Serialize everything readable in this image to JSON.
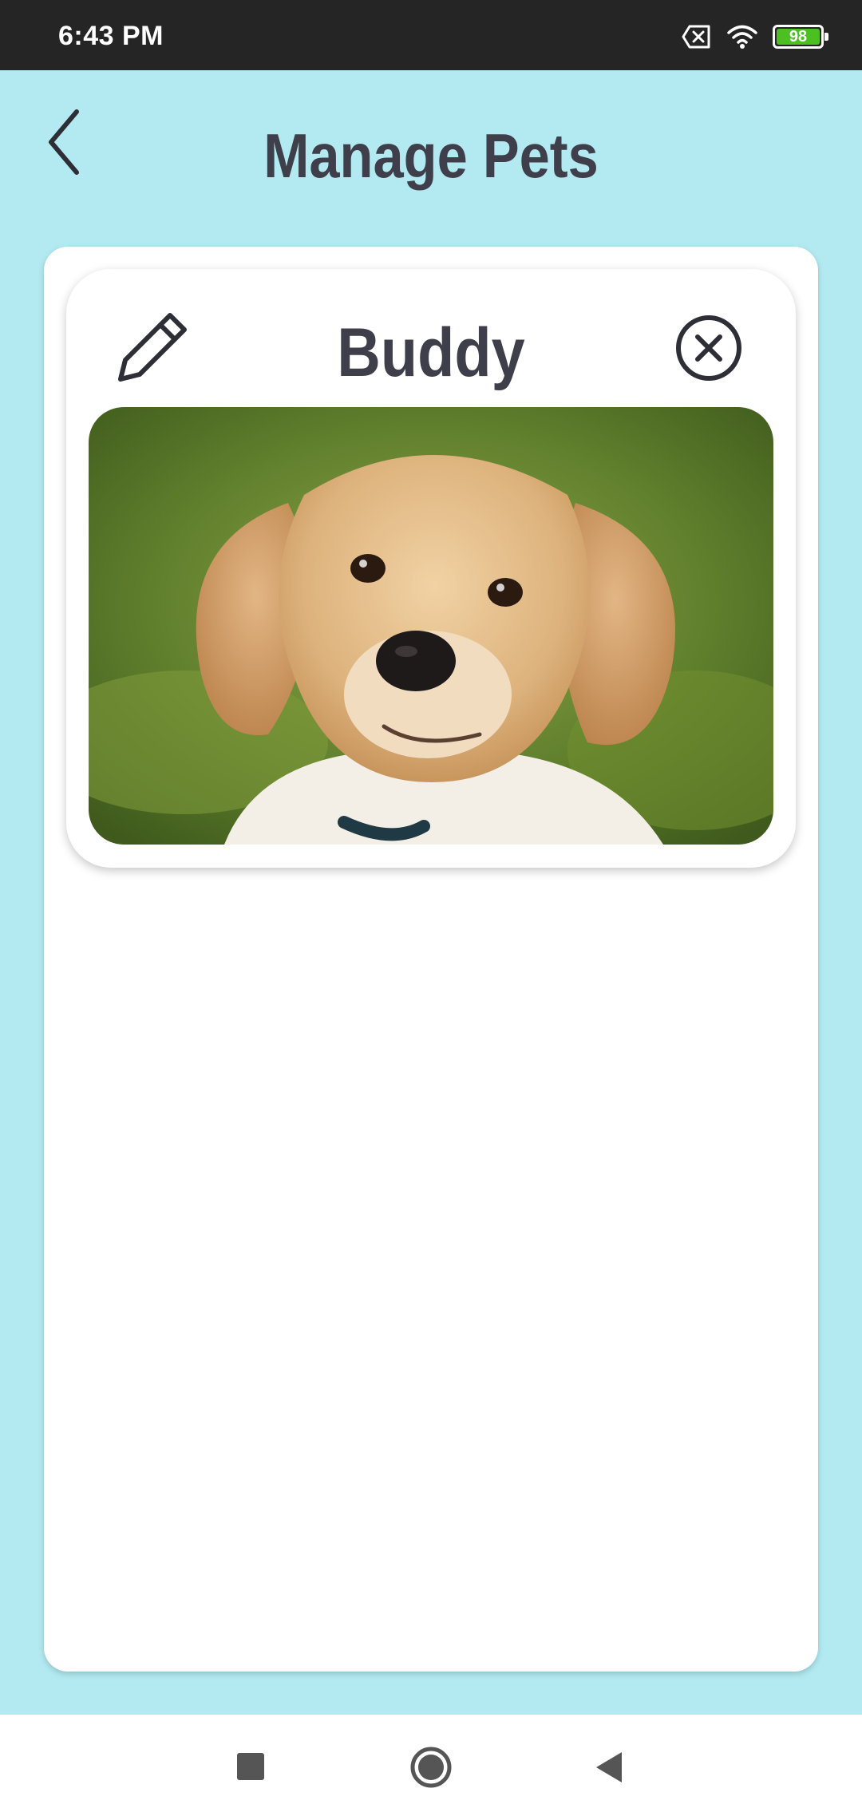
{
  "status_bar": {
    "time": "6:43 PM",
    "battery_level": "98",
    "icons": [
      "sim-off-icon",
      "wifi-icon",
      "battery-icon"
    ]
  },
  "header": {
    "title": "Manage Pets",
    "back_icon": "chevron-left-icon"
  },
  "pets": [
    {
      "name": "Buddy",
      "edit_icon": "pencil-icon",
      "delete_icon": "close-circle-icon",
      "photo": "golden retriever puppy photo"
    }
  ],
  "nav_bar": {
    "buttons": [
      "recent-apps-icon",
      "home-icon",
      "back-icon"
    ]
  },
  "colors": {
    "background": "#b3eaf2",
    "status_bar": "#252525",
    "title_text": "#3f3f4c",
    "battery_fill": "#4cc021"
  }
}
